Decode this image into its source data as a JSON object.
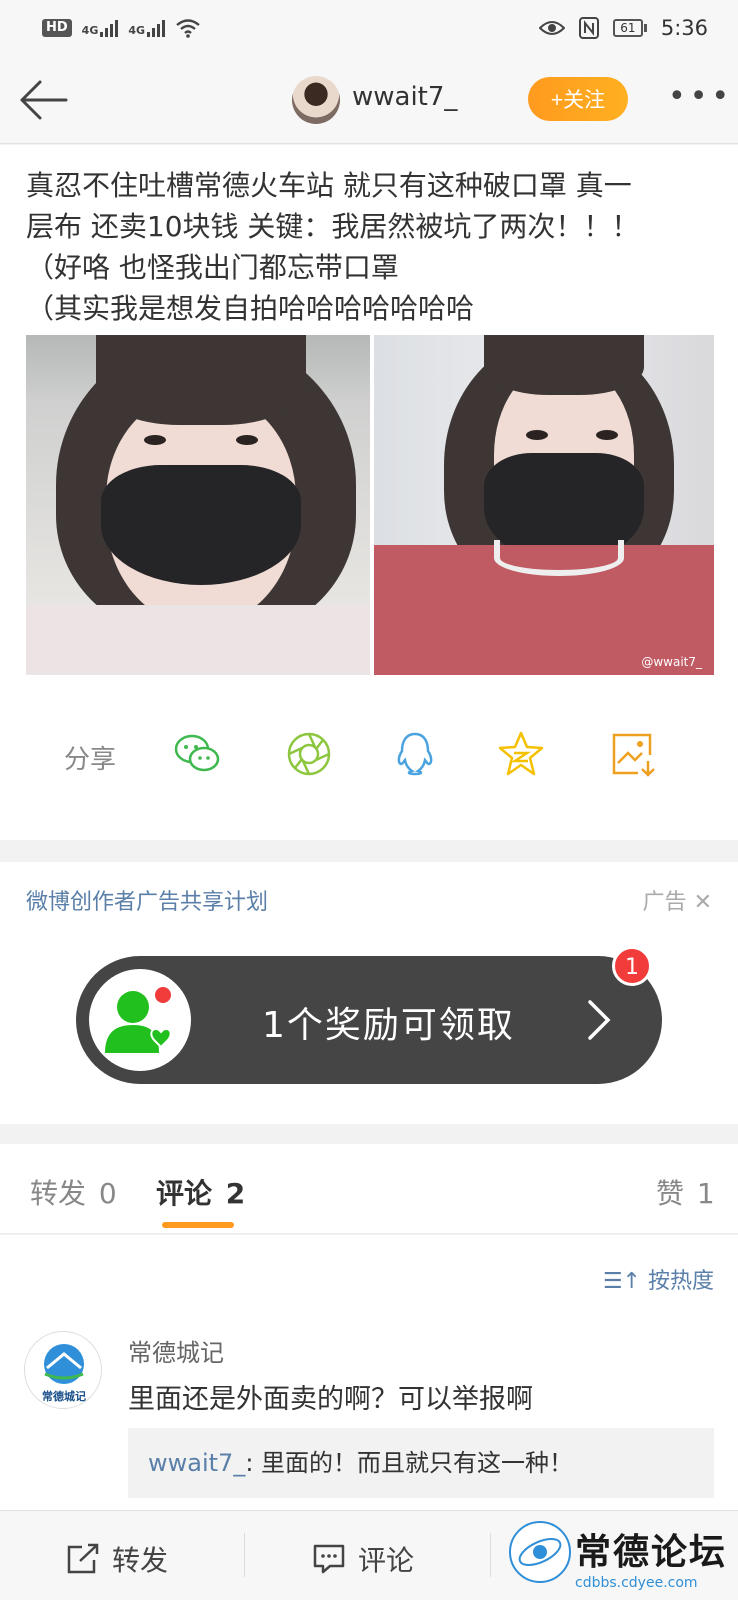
{
  "status_bar": {
    "hd": "HD",
    "network1": "4G",
    "network2": "4G",
    "battery": "61",
    "time": "5:36"
  },
  "header": {
    "username": "wwait7_",
    "follow_label": "+关注"
  },
  "post": {
    "lines": [
      "真忍不住吐槽常德火车站 就只有这种破口罩 真一",
      "层布 还卖10块钱 关键：我居然被坑了两次！！！",
      "（好咯 也怪我出门都忘带口罩",
      "（其实我是想发自拍哈哈哈哈哈哈哈"
    ],
    "photo_watermark": "@wwait7_"
  },
  "share": {
    "label": "分享",
    "icons": [
      "wechat-icon",
      "moments-icon",
      "qq-icon",
      "qzone-icon",
      "save-image-icon"
    ]
  },
  "ad": {
    "title": "微博创作者广告共享计划",
    "tag": "广告",
    "reward_text": "1个奖励可领取",
    "badge_count": "1"
  },
  "tabs": {
    "repost_label": "转发",
    "repost_count": "0",
    "comment_label": "评论",
    "comment_count": "2",
    "like_label": "赞",
    "like_count": "1"
  },
  "comments": {
    "sort_label": "按热度",
    "items": [
      {
        "name": "常德城记",
        "avatar_text": "常德城记",
        "text": "里面还是外面卖的啊？可以举报啊",
        "reply_user": "wwait7_",
        "reply_text": ": 里面的！而且就只有这一种！"
      }
    ]
  },
  "bottom_bar": {
    "repost_label": "转发",
    "comment_label": "评论",
    "logo_text": "常德论坛",
    "logo_url": "cdbbs.cdyee.com"
  },
  "colors": {
    "accent_orange": "#ff9a1f",
    "link_blue": "#5a7fa8",
    "badge_red": "#f23c3c",
    "reward_bg": "#454545"
  }
}
